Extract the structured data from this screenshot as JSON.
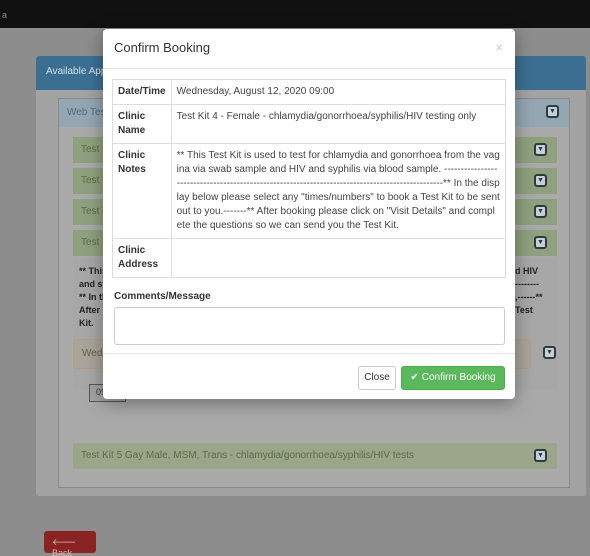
{
  "page": {
    "top_mark": "a",
    "panel_title": "Available Appo",
    "web_header": "Web Teste",
    "kits": [
      "Test Kit",
      "Test Kit",
      "Test Kit",
      "Test Kit"
    ],
    "kit_body": {
      "line1": "** This",
      "line2": "and sy",
      "line3": "** In th",
      "line4": "After b",
      "line5": "Kit.",
      "right1": "d HIV",
      "right2": "--------",
      "right3": ",------**",
      "right4": "Test"
    },
    "slot_label": "Wed",
    "slot_time": "09:00",
    "kit5": "Test Kit 5 Gay Male, MSM, Trans - chlamydia/gonorrhoea/syphilis/HIV tests",
    "back_label": "Back"
  },
  "modal": {
    "title": "Confirm Booking",
    "close_symbol": "×",
    "rows": {
      "datetime_label": "Date/Time",
      "datetime_value": "Wednesday, August 12, 2020 09:00",
      "clinic_name_label": "Clinic Name",
      "clinic_name_value": "Test Kit 4 - Female - chlamydia/gonorrhoea/syphilis/HIV testing only",
      "clinic_notes_label": "Clinic Notes",
      "clinic_notes_value": "** This Test Kit is used to test for chlamydia and gonorrhoea from the vagina via swab sample and HIV and syphilis via blood sample. ------------------------------------------------------------------------------------------------** In the display below please select any \"times/numbers\" to book a Test Kit to be sent out to you.-------** After booking please click on \"Visit Details\" and complete the questions so we can send you the Test Kit.",
      "clinic_address_label": "Clinic Address",
      "clinic_address_value": ""
    },
    "comments_label": "Comments/Message",
    "comments_value": "",
    "close_button": "Close",
    "confirm_button": "Confirm Booking"
  },
  "colors": {
    "confirm_green": "#5cb85c",
    "panel_blue": "#3b6f92",
    "back_red": "#8a2424"
  }
}
